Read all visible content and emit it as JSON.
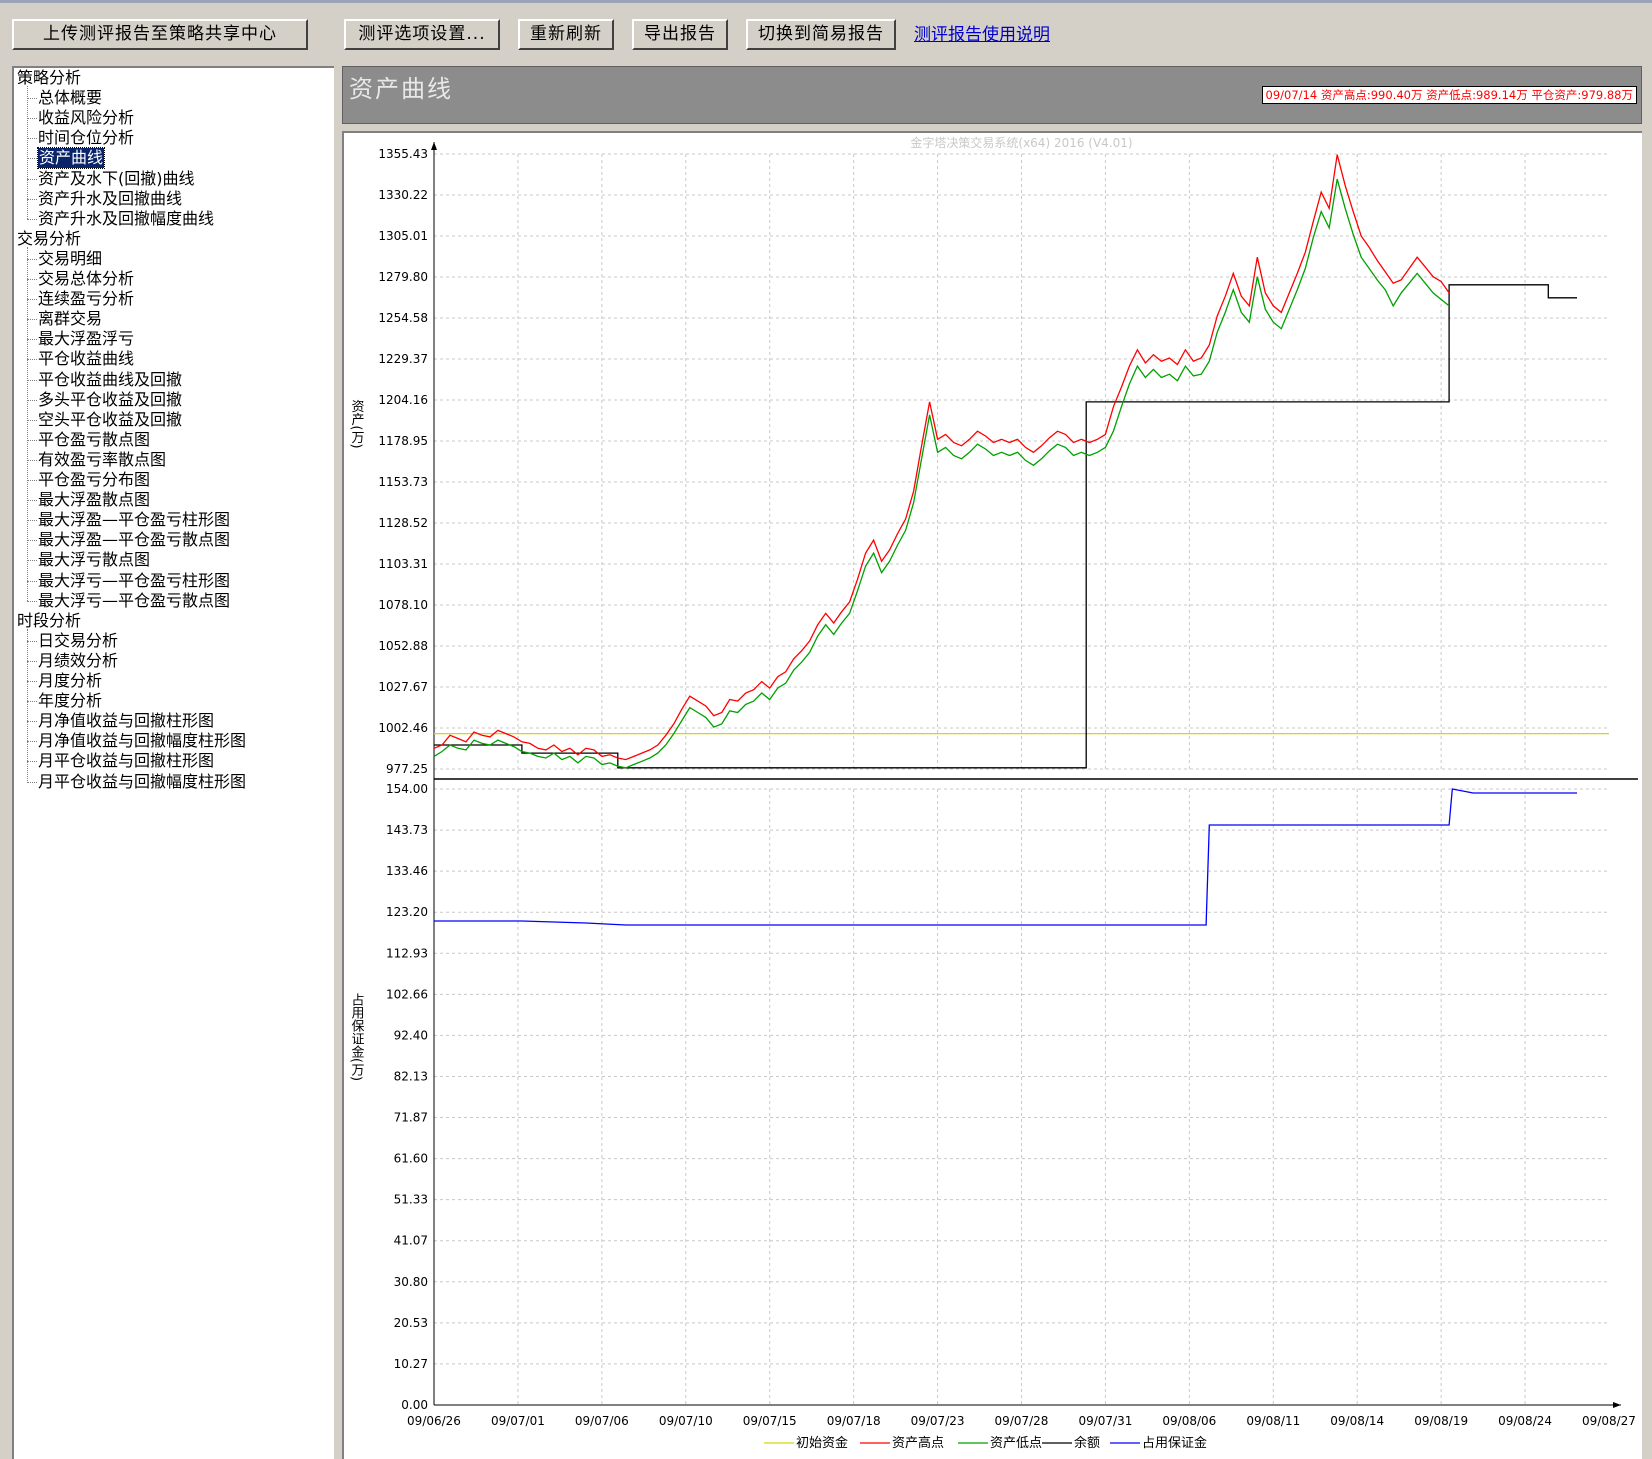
{
  "toolbar": {
    "upload_label": "上传测评报告至策略共享中心",
    "options_label": "测评选项设置...",
    "refresh_label": "重新刷新",
    "export_label": "导出报告",
    "switch_label": "切换到简易报告",
    "help_link": "测评报告使用说明"
  },
  "tree": {
    "groups": [
      {
        "label": "策略分析",
        "items": [
          "总体概要",
          "收益风险分析",
          "时间仓位分析",
          "资产曲线",
          "资产及水下(回撤)曲线",
          "资产升水及回撤曲线",
          "资产升水及回撤幅度曲线"
        ]
      },
      {
        "label": "交易分析",
        "items": [
          "交易明细",
          "交易总体分析",
          "连续盈亏分析",
          "离群交易",
          "最大浮盈浮亏",
          "平仓收益曲线",
          "平仓收益曲线及回撤",
          "多头平仓收益及回撤",
          "空头平仓收益及回撤",
          "平仓盈亏散点图",
          "有效盈亏率散点图",
          "平仓盈亏分布图",
          "最大浮盈散点图",
          "最大浮盈—平仓盈亏柱形图",
          "最大浮盈—平仓盈亏散点图",
          "最大浮亏散点图",
          "最大浮亏—平仓盈亏柱形图",
          "最大浮亏—平仓盈亏散点图"
        ]
      },
      {
        "label": "时段分析",
        "items": [
          "日交易分析",
          "月绩效分析",
          "月度分析",
          "年度分析",
          "月净值收益与回撤柱形图",
          "月净值收益与回撤幅度柱形图",
          "月平仓收益与回撤柱形图",
          "月平仓收益与回撤幅度柱形图"
        ]
      }
    ],
    "selected": "资产曲线"
  },
  "header": {
    "title": "资产曲线",
    "info": "09/07/14 资产高点:990.40万   资产低点:989.14万   平仓资产:979.88万"
  },
  "chart_data": {
    "type": "line",
    "watermark": "金字塔决策交易系统(x64) 2016 (V4.01)",
    "x_ticks": [
      "09/06/26",
      "09/07/01",
      "09/07/06",
      "09/07/10",
      "09/07/15",
      "09/07/18",
      "09/07/23",
      "09/07/28",
      "09/07/31",
      "09/08/06",
      "09/08/11",
      "09/08/14",
      "09/08/19",
      "09/08/24",
      "09/08/27"
    ],
    "colors": {
      "initial": "#d8d800",
      "high": "#ff0000",
      "low": "#00a000",
      "balance": "#000000",
      "margin": "#0000ff"
    },
    "top": {
      "ylabel": "资产(万)",
      "ylim": [
        977.25,
        1355.43
      ],
      "y_ticks": [
        "1355.43",
        "1330.22",
        "1305.01",
        "1279.80",
        "1254.58",
        "1229.37",
        "1204.16",
        "1178.95",
        "1153.73",
        "1128.52",
        "1103.31",
        "1078.10",
        "1052.88",
        "1027.67",
        "1002.46",
        "977.25"
      ],
      "initial_capital": 999.0,
      "high_points": [
        [
          0,
          990
        ],
        [
          0.5,
          992
        ],
        [
          1,
          998
        ],
        [
          1.5,
          996
        ],
        [
          2,
          994
        ],
        [
          2.5,
          1000
        ],
        [
          3,
          998
        ],
        [
          3.5,
          997
        ],
        [
          4,
          1001
        ],
        [
          4.5,
          999
        ],
        [
          5,
          997
        ],
        [
          5.5,
          994
        ],
        [
          6,
          993
        ],
        [
          6.5,
          990
        ],
        [
          7,
          989
        ],
        [
          7.5,
          992
        ],
        [
          8,
          988
        ],
        [
          8.5,
          990
        ],
        [
          9,
          986
        ],
        [
          9.5,
          990
        ],
        [
          10,
          989
        ],
        [
          10.5,
          985
        ],
        [
          11,
          986
        ],
        [
          11.5,
          984
        ],
        [
          12,
          983
        ],
        [
          12.5,
          985
        ],
        [
          13,
          987
        ],
        [
          13.5,
          989
        ],
        [
          14,
          992
        ],
        [
          14.5,
          998
        ],
        [
          15,
          1005
        ],
        [
          15.5,
          1014
        ],
        [
          16,
          1022
        ],
        [
          16.5,
          1019
        ],
        [
          17,
          1016
        ],
        [
          17.5,
          1010
        ],
        [
          18,
          1012
        ],
        [
          18.5,
          1020
        ],
        [
          19,
          1019
        ],
        [
          19.5,
          1024
        ],
        [
          20,
          1026
        ],
        [
          20.5,
          1031
        ],
        [
          21,
          1027
        ],
        [
          21.5,
          1034
        ],
        [
          22,
          1037
        ],
        [
          22.5,
          1045
        ],
        [
          23,
          1050
        ],
        [
          23.5,
          1056
        ],
        [
          24,
          1066
        ],
        [
          24.5,
          1073
        ],
        [
          25,
          1067
        ],
        [
          25.5,
          1074
        ],
        [
          26,
          1080
        ],
        [
          26.5,
          1094
        ],
        [
          27,
          1110
        ],
        [
          27.5,
          1118
        ],
        [
          28,
          1105
        ],
        [
          28.5,
          1112
        ],
        [
          29,
          1122
        ],
        [
          29.5,
          1131
        ],
        [
          30,
          1148
        ],
        [
          30.5,
          1176
        ],
        [
          31,
          1203
        ],
        [
          31.5,
          1180
        ],
        [
          32,
          1183
        ],
        [
          32.5,
          1178
        ],
        [
          33,
          1176
        ],
        [
          33.5,
          1180
        ],
        [
          34,
          1185
        ],
        [
          34.5,
          1182
        ],
        [
          35,
          1178
        ],
        [
          35.5,
          1180
        ],
        [
          36,
          1178
        ],
        [
          36.5,
          1180
        ],
        [
          37,
          1175
        ],
        [
          37.5,
          1172
        ],
        [
          38,
          1176
        ],
        [
          38.5,
          1181
        ],
        [
          39,
          1185
        ],
        [
          39.5,
          1183
        ],
        [
          40,
          1178
        ],
        [
          40.5,
          1180
        ],
        [
          41,
          1178
        ],
        [
          41.5,
          1180
        ],
        [
          42,
          1183
        ],
        [
          42.5,
          1200
        ],
        [
          43,
          1212
        ],
        [
          43.5,
          1225
        ],
        [
          44,
          1235
        ],
        [
          44.5,
          1227
        ],
        [
          45,
          1232
        ],
        [
          45.5,
          1228
        ],
        [
          46,
          1230
        ],
        [
          46.5,
          1226
        ],
        [
          47,
          1235
        ],
        [
          47.5,
          1228
        ],
        [
          48,
          1230
        ],
        [
          48.5,
          1238
        ],
        [
          49,
          1256
        ],
        [
          49.5,
          1268
        ],
        [
          50,
          1282
        ],
        [
          50.5,
          1268
        ],
        [
          51,
          1262
        ],
        [
          51.5,
          1292
        ],
        [
          52,
          1270
        ],
        [
          52.5,
          1262
        ],
        [
          53,
          1258
        ],
        [
          53.5,
          1270
        ],
        [
          54,
          1282
        ],
        [
          54.5,
          1295
        ],
        [
          55,
          1314
        ],
        [
          55.5,
          1332
        ],
        [
          56,
          1322
        ],
        [
          56.5,
          1355
        ],
        [
          57,
          1336
        ],
        [
          57.5,
          1320
        ],
        [
          58,
          1305
        ],
        [
          58.5,
          1298
        ],
        [
          59,
          1290
        ],
        [
          59.5,
          1283
        ],
        [
          60,
          1276
        ],
        [
          60.5,
          1278
        ],
        [
          61,
          1285
        ],
        [
          61.5,
          1292
        ],
        [
          62,
          1286
        ],
        [
          62.5,
          1280
        ],
        [
          63,
          1277
        ],
        [
          63.5,
          1270
        ]
      ],
      "low_points": [
        [
          0,
          985
        ],
        [
          0.5,
          988
        ],
        [
          1,
          992
        ],
        [
          1.5,
          990
        ],
        [
          2,
          989
        ],
        [
          2.5,
          995
        ],
        [
          3,
          993
        ],
        [
          3.5,
          992
        ],
        [
          4,
          995
        ],
        [
          4.5,
          993
        ],
        [
          5,
          991
        ],
        [
          5.5,
          988
        ],
        [
          6,
          987
        ],
        [
          6.5,
          985
        ],
        [
          7,
          984
        ],
        [
          7.5,
          987
        ],
        [
          8,
          983
        ],
        [
          8.5,
          985
        ],
        [
          9,
          981
        ],
        [
          9.5,
          985
        ],
        [
          10,
          984
        ],
        [
          10.5,
          980
        ],
        [
          11,
          981
        ],
        [
          11.5,
          979
        ],
        [
          12,
          978
        ],
        [
          12.5,
          980
        ],
        [
          13,
          982
        ],
        [
          13.5,
          984
        ],
        [
          14,
          987
        ],
        [
          14.5,
          992
        ],
        [
          15,
          999
        ],
        [
          15.5,
          1007
        ],
        [
          16,
          1015
        ],
        [
          16.5,
          1012
        ],
        [
          17,
          1009
        ],
        [
          17.5,
          1003
        ],
        [
          18,
          1005
        ],
        [
          18.5,
          1013
        ],
        [
          19,
          1012
        ],
        [
          19.5,
          1017
        ],
        [
          20,
          1019
        ],
        [
          20.5,
          1024
        ],
        [
          21,
          1020
        ],
        [
          21.5,
          1027
        ],
        [
          22,
          1030
        ],
        [
          22.5,
          1038
        ],
        [
          23,
          1043
        ],
        [
          23.5,
          1049
        ],
        [
          24,
          1059
        ],
        [
          24.5,
          1066
        ],
        [
          25,
          1060
        ],
        [
          25.5,
          1067
        ],
        [
          26,
          1073
        ],
        [
          26.5,
          1087
        ],
        [
          27,
          1102
        ],
        [
          27.5,
          1110
        ],
        [
          28,
          1098
        ],
        [
          28.5,
          1105
        ],
        [
          29,
          1115
        ],
        [
          29.5,
          1124
        ],
        [
          30,
          1141
        ],
        [
          30.5,
          1168
        ],
        [
          31,
          1195
        ],
        [
          31.5,
          1172
        ],
        [
          32,
          1175
        ],
        [
          32.5,
          1170
        ],
        [
          33,
          1168
        ],
        [
          33.5,
          1172
        ],
        [
          34,
          1177
        ],
        [
          34.5,
          1174
        ],
        [
          35,
          1170
        ],
        [
          35.5,
          1172
        ],
        [
          36,
          1170
        ],
        [
          36.5,
          1172
        ],
        [
          37,
          1167
        ],
        [
          37.5,
          1164
        ],
        [
          38,
          1168
        ],
        [
          38.5,
          1173
        ],
        [
          39,
          1177
        ],
        [
          39.5,
          1175
        ],
        [
          40,
          1170
        ],
        [
          40.5,
          1172
        ],
        [
          41,
          1170
        ],
        [
          41.5,
          1172
        ],
        [
          42,
          1175
        ],
        [
          42.5,
          1185
        ],
        [
          43,
          1200
        ],
        [
          43.5,
          1214
        ],
        [
          44,
          1225
        ],
        [
          44.5,
          1218
        ],
        [
          45,
          1223
        ],
        [
          45.5,
          1218
        ],
        [
          46,
          1220
        ],
        [
          46.5,
          1216
        ],
        [
          47,
          1225
        ],
        [
          47.5,
          1219
        ],
        [
          48,
          1220
        ],
        [
          48.5,
          1228
        ],
        [
          49,
          1246
        ],
        [
          49.5,
          1258
        ],
        [
          50,
          1272
        ],
        [
          50.5,
          1258
        ],
        [
          51,
          1252
        ],
        [
          51.5,
          1280
        ],
        [
          52,
          1260
        ],
        [
          52.5,
          1252
        ],
        [
          53,
          1248
        ],
        [
          53.5,
          1260
        ],
        [
          54,
          1272
        ],
        [
          54.5,
          1285
        ],
        [
          55,
          1304
        ],
        [
          55.5,
          1320
        ],
        [
          56,
          1310
        ],
        [
          56.5,
          1340
        ],
        [
          57,
          1322
        ],
        [
          57.5,
          1306
        ],
        [
          58,
          1292
        ],
        [
          58.5,
          1285
        ],
        [
          59,
          1278
        ],
        [
          59.5,
          1272
        ],
        [
          60,
          1262
        ],
        [
          60.5,
          1270
        ],
        [
          61,
          1276
        ],
        [
          61.5,
          1282
        ],
        [
          62,
          1276
        ],
        [
          62.5,
          1270
        ],
        [
          63,
          1266
        ],
        [
          63.5,
          1262
        ]
      ],
      "balance_points": [
        [
          0,
          992
        ],
        [
          5.5,
          992
        ],
        [
          5.5,
          987
        ],
        [
          11.5,
          987
        ],
        [
          11.5,
          978
        ],
        [
          40.8,
          978
        ],
        [
          40.8,
          1203
        ],
        [
          63.5,
          1203
        ],
        [
          63.5,
          1275
        ],
        [
          69.7,
          1275
        ],
        [
          69.7,
          1267
        ],
        [
          71.5,
          1267
        ]
      ]
    },
    "bottom": {
      "ylabel": "占用保证金(万)",
      "ylim": [
        0.0,
        154.0
      ],
      "y_ticks": [
        "154.00",
        "143.73",
        "133.46",
        "123.20",
        "112.93",
        "102.66",
        "92.40",
        "82.13",
        "71.87",
        "61.60",
        "51.33",
        "41.07",
        "30.80",
        "20.53",
        "10.27",
        "0.00"
      ],
      "margin_points": [
        [
          0,
          121
        ],
        [
          5.5,
          121
        ],
        [
          9.5,
          120.5
        ],
        [
          12,
          120
        ],
        [
          30,
          120
        ],
        [
          48.3,
          120
        ],
        [
          48.5,
          145
        ],
        [
          63.5,
          145
        ],
        [
          63.7,
          154
        ],
        [
          65,
          153
        ],
        [
          71.5,
          153
        ]
      ]
    },
    "legend": [
      "初始资金",
      "资产高点",
      "资产低点",
      "余额",
      "占用保证金"
    ]
  }
}
